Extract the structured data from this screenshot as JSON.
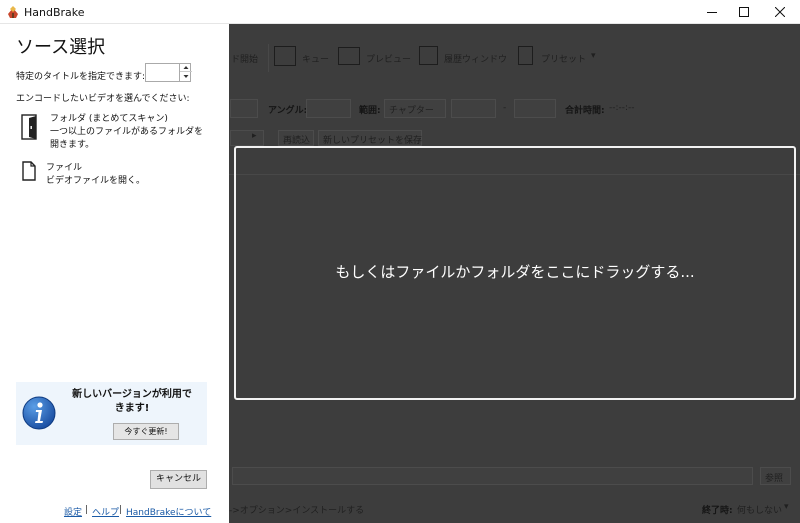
{
  "window": {
    "title": "HandBrake"
  },
  "toolbar": {
    "start_label": "ド開始",
    "queue_label": "キュー",
    "preview_label": "プレビュー",
    "activity_label": "履歴ウィンドウ",
    "presets_label": "プリセット"
  },
  "source_options": {
    "angle_label": "アングル:",
    "range_label": "範囲:",
    "range_value": "チャプター",
    "range_sep": "-",
    "duration_label": "合計時間:",
    "duration_value": "--:--:--",
    "reload_label": "再読込",
    "save_preset_label": "新しいプリセットを保存"
  },
  "bottom": {
    "browse_label": "参照",
    "status_text": "->オプション>インストールする",
    "when_done_label": "終了時:",
    "when_done_value": "何もしない"
  },
  "dropzone": {
    "text": "もしくはファイルかフォルダをここにドラッグする..."
  },
  "source_panel": {
    "title": "ソース選択",
    "title_spec_label": "特定のタイトルを指定できます:",
    "title_spec_value": "",
    "choose_label": "エンコードしたいビデオを選んでください:",
    "folder": {
      "title": "フォルダ (まとめてスキャン)",
      "line2": "一つ以上のファイルがあるフォルダを",
      "line3": "開きます。"
    },
    "file": {
      "title": "ファイル",
      "line2": "ビデオファイルを開く。"
    },
    "update_notice": {
      "line1": "新しいバージョンが利用で",
      "line2": "きます!",
      "button": "今すぐ更新!"
    },
    "cancel_label": "キャンセル",
    "links": {
      "settings": "設定",
      "help": "ヘルプ",
      "about": "HandBrakeについて"
    },
    "link_sep": "|"
  }
}
